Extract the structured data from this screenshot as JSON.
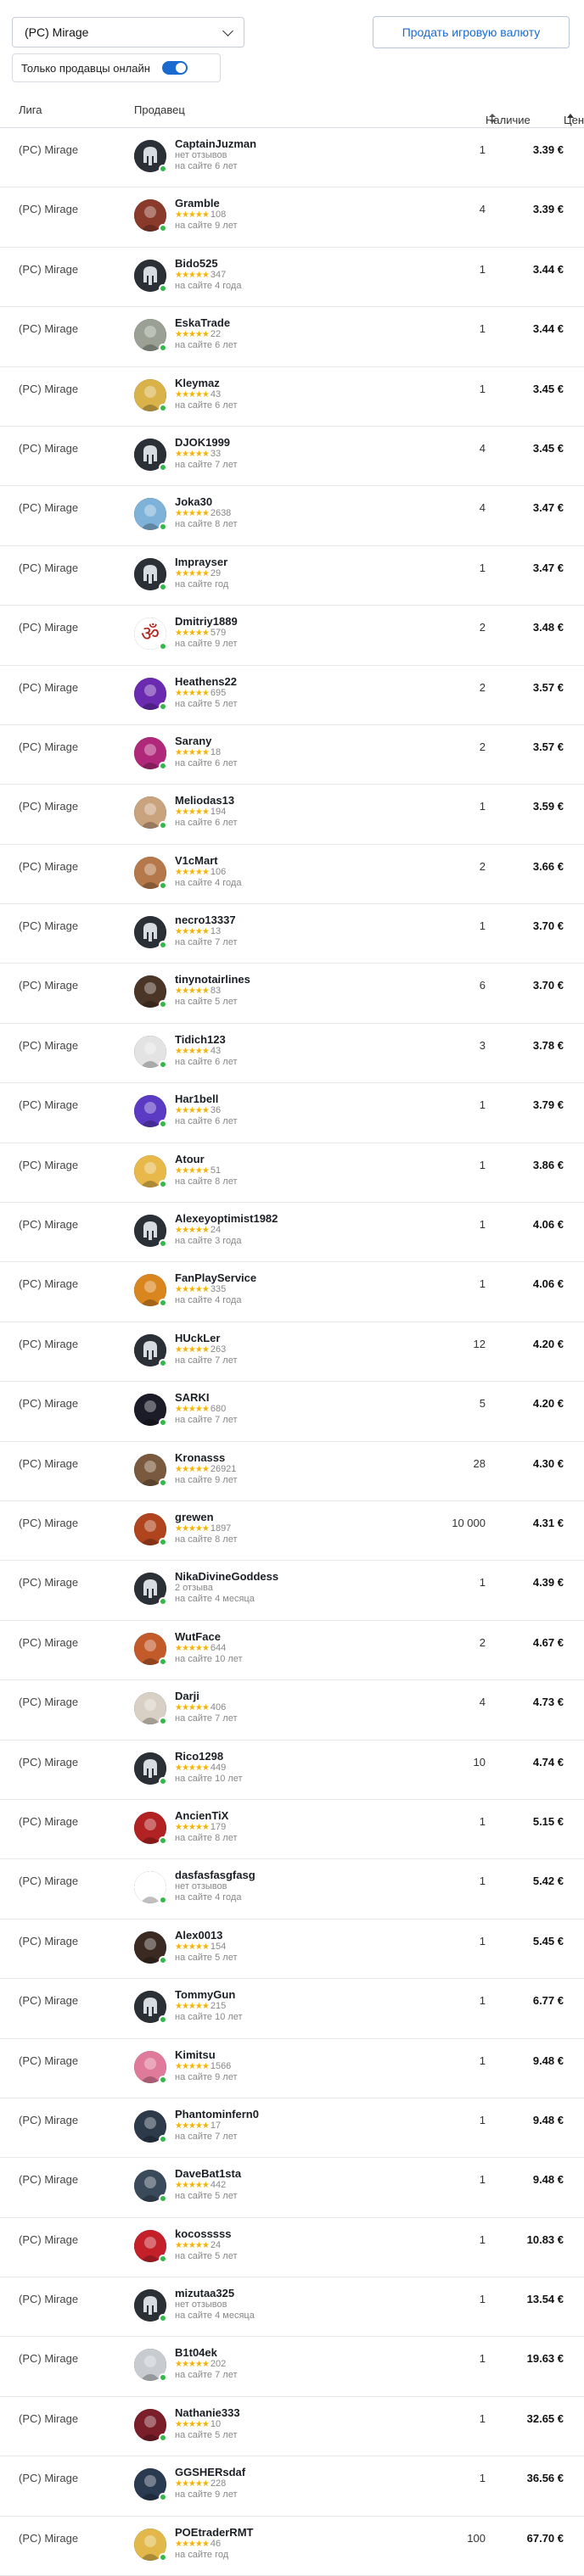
{
  "league_select": {
    "value": "(PC) Mirage"
  },
  "sell_button": "Продать игровую валюту",
  "online_filter": {
    "label": "Только продавцы онлайн",
    "enabled": true
  },
  "columns": {
    "league": "Лига",
    "seller": "Продавец",
    "stock": "Наличие",
    "price": "Цена"
  },
  "rows": [
    {
      "league": "(PC) Mirage",
      "name": "CaptainJuzman",
      "rating": "нет отзывов",
      "age": "на сайте 6 лет",
      "stock": "1",
      "price": "3.39 €",
      "avatar_color": "#2b2f36",
      "avatar_icon": "helmet-icon"
    },
    {
      "league": "(PC) Mirage",
      "name": "Gramble",
      "rating": "108",
      "age": "на сайте 9 лет",
      "stock": "4",
      "price": "3.39 €",
      "avatar_color": "#8a3a2a",
      "avatar_icon": "character-icon"
    },
    {
      "league": "(PC) Mirage",
      "name": "Bido525",
      "rating": "347",
      "age": "на сайте 4 года",
      "stock": "1",
      "price": "3.44 €",
      "avatar_color": "#2b2f36",
      "avatar_icon": "helmet-icon"
    },
    {
      "league": "(PC) Mirage",
      "name": "EskaTrade",
      "rating": "22",
      "age": "на сайте 6 лет",
      "stock": "1",
      "price": "3.44 €",
      "avatar_color": "#9aa093",
      "avatar_icon": "character-icon"
    },
    {
      "league": "(PC) Mirage",
      "name": "Kleymaz",
      "rating": "43",
      "age": "на сайте 6 лет",
      "stock": "1",
      "price": "3.45 €",
      "avatar_color": "#d9b24a",
      "avatar_icon": "character-icon"
    },
    {
      "league": "(PC) Mirage",
      "name": "DJOK1999",
      "rating": "33",
      "age": "на сайте 7 лет",
      "stock": "4",
      "price": "3.45 €",
      "avatar_color": "#2b2f36",
      "avatar_icon": "helmet-icon"
    },
    {
      "league": "(PC) Mirage",
      "name": "Joka30",
      "rating": "2638",
      "age": "на сайте 8 лет",
      "stock": "4",
      "price": "3.47 €",
      "avatar_color": "#7fb2d8",
      "avatar_icon": "character-icon"
    },
    {
      "league": "(PC) Mirage",
      "name": "Imprayser",
      "rating": "29",
      "age": "на сайте год",
      "stock": "1",
      "price": "3.47 €",
      "avatar_color": "#2b2f36",
      "avatar_icon": "helmet-icon"
    },
    {
      "league": "(PC) Mirage",
      "name": "Dmitriy1889",
      "rating": "579",
      "age": "на сайте 9 лет",
      "stock": "2",
      "price": "3.48 €",
      "avatar_color": "#b3261e",
      "avatar_icon": "om-symbol-icon"
    },
    {
      "league": "(PC) Mirage",
      "name": "Heathens22",
      "rating": "695",
      "age": "на сайте 5 лет",
      "stock": "2",
      "price": "3.57 €",
      "avatar_color": "#6a2bb0",
      "avatar_icon": "character-icon"
    },
    {
      "league": "(PC) Mirage",
      "name": "Sarany",
      "rating": "18",
      "age": "на сайте 6 лет",
      "stock": "2",
      "price": "3.57 €",
      "avatar_color": "#b0287a",
      "avatar_icon": "character-icon"
    },
    {
      "league": "(PC) Mirage",
      "name": "Meliodas13",
      "rating": "194",
      "age": "на сайте 6 лет",
      "stock": "1",
      "price": "3.59 €",
      "avatar_color": "#c9a27e",
      "avatar_icon": "character-icon"
    },
    {
      "league": "(PC) Mirage",
      "name": "V1cMart",
      "rating": "106",
      "age": "на сайте 4 года",
      "stock": "2",
      "price": "3.66 €",
      "avatar_color": "#b5784a",
      "avatar_icon": "character-icon"
    },
    {
      "league": "(PC) Mirage",
      "name": "necro13337",
      "rating": "13",
      "age": "на сайте 7 лет",
      "stock": "1",
      "price": "3.70 €",
      "avatar_color": "#2b2f36",
      "avatar_icon": "helmet-icon"
    },
    {
      "league": "(PC) Mirage",
      "name": "tinynotairlines",
      "rating": "83",
      "age": "на сайте 5 лет",
      "stock": "6",
      "price": "3.70 €",
      "avatar_color": "#4a3526",
      "avatar_icon": "character-icon"
    },
    {
      "league": "(PC) Mirage",
      "name": "Tidich123",
      "rating": "43",
      "age": "на сайте 6 лет",
      "stock": "3",
      "price": "3.78 €",
      "avatar_color": "#e3e3e3",
      "avatar_icon": "character-icon"
    },
    {
      "league": "(PC) Mirage",
      "name": "Har1bell",
      "rating": "36",
      "age": "на сайте 6 лет",
      "stock": "1",
      "price": "3.79 €",
      "avatar_color": "#5b3bc4",
      "avatar_icon": "character-icon"
    },
    {
      "league": "(PC) Mirage",
      "name": "Atour",
      "rating": "51",
      "age": "на сайте 8 лет",
      "stock": "1",
      "price": "3.86 €",
      "avatar_color": "#e8b84a",
      "avatar_icon": "character-icon"
    },
    {
      "league": "(PC) Mirage",
      "name": "Alexeyoptimist1982",
      "rating": "24",
      "age": "на сайте 3 года",
      "stock": "1",
      "price": "4.06 €",
      "avatar_color": "#2b2f36",
      "avatar_icon": "helmet-icon"
    },
    {
      "league": "(PC) Mirage",
      "name": "FanPlayService",
      "rating": "335",
      "age": "на сайте 4 года",
      "stock": "1",
      "price": "4.06 €",
      "avatar_color": "#d9861e",
      "avatar_icon": "character-icon"
    },
    {
      "league": "(PC) Mirage",
      "name": "HUckLer",
      "rating": "263",
      "age": "на сайте 7 лет",
      "stock": "12",
      "price": "4.20 €",
      "avatar_color": "#2b2f36",
      "avatar_icon": "helmet-icon"
    },
    {
      "league": "(PC) Mirage",
      "name": "SARKI",
      "rating": "680",
      "age": "на сайте 7 лет",
      "stock": "5",
      "price": "4.20 €",
      "avatar_color": "#1c1c28",
      "avatar_icon": "character-icon"
    },
    {
      "league": "(PC) Mirage",
      "name": "Kronasss",
      "rating": "26921",
      "age": "на сайте 9 лет",
      "stock": "28",
      "price": "4.30 €",
      "avatar_color": "#7a5a3e",
      "avatar_icon": "character-icon"
    },
    {
      "league": "(PC) Mirage",
      "name": "grewen",
      "rating": "1897",
      "age": "на сайте 8 лет",
      "stock": "10 000",
      "price": "4.31 €",
      "avatar_color": "#b0441e",
      "avatar_icon": "character-icon"
    },
    {
      "league": "(PC) Mirage",
      "name": "NikaDivineGoddess",
      "rating": "2 отзыва",
      "age": "на сайте 4 месяца",
      "stock": "1",
      "price": "4.39 €",
      "avatar_color": "#2b2f36",
      "avatar_icon": "helmet-icon"
    },
    {
      "league": "(PC) Mirage",
      "name": "WutFace",
      "rating": "644",
      "age": "на сайте 10 лет",
      "stock": "2",
      "price": "4.67 €",
      "avatar_color": "#c25a2a",
      "avatar_icon": "character-icon"
    },
    {
      "league": "(PC) Mirage",
      "name": "Darji",
      "rating": "406",
      "age": "на сайте 7 лет",
      "stock": "4",
      "price": "4.73 €",
      "avatar_color": "#d8d0c4",
      "avatar_icon": "character-icon"
    },
    {
      "league": "(PC) Mirage",
      "name": "Rico1298",
      "rating": "449",
      "age": "на сайте 10 лет",
      "stock": "10",
      "price": "4.74 €",
      "avatar_color": "#2b2f36",
      "avatar_icon": "helmet-icon"
    },
    {
      "league": "(PC) Mirage",
      "name": "AncienTiX",
      "rating": "179",
      "age": "на сайте 8 лет",
      "stock": "1",
      "price": "5.15 €",
      "avatar_color": "#b32222",
      "avatar_icon": "character-icon"
    },
    {
      "league": "(PC) Mirage",
      "name": "dasfasfasgfasg",
      "rating": "нет отзывов",
      "age": "на сайте 4 года",
      "stock": "1",
      "price": "5.42 €",
      "avatar_color": "#ffffff",
      "avatar_icon": "character-icon"
    },
    {
      "league": "(PC) Mirage",
      "name": "Alex0013",
      "rating": "154",
      "age": "на сайте 5 лет",
      "stock": "1",
      "price": "5.45 €",
      "avatar_color": "#3a2a22",
      "avatar_icon": "character-icon"
    },
    {
      "league": "(PC) Mirage",
      "name": "TommyGun",
      "rating": "215",
      "age": "на сайте 10 лет",
      "stock": "1",
      "price": "6.77 €",
      "avatar_color": "#2b2f36",
      "avatar_icon": "helmet-icon"
    },
    {
      "league": "(PC) Mirage",
      "name": "Kimitsu",
      "rating": "1566",
      "age": "на сайте 9 лет",
      "stock": "1",
      "price": "9.48 €",
      "avatar_color": "#e07a9a",
      "avatar_icon": "character-icon"
    },
    {
      "league": "(PC) Mirage",
      "name": "Phantominfern0",
      "rating": "17",
      "age": "на сайте 7 лет",
      "stock": "1",
      "price": "9.48 €",
      "avatar_color": "#2c3a4a",
      "avatar_icon": "character-icon"
    },
    {
      "league": "(PC) Mirage",
      "name": "DaveBat1sta",
      "rating": "442",
      "age": "на сайте 5 лет",
      "stock": "1",
      "price": "9.48 €",
      "avatar_color": "#3a4a5a",
      "avatar_icon": "character-icon"
    },
    {
      "league": "(PC) Mirage",
      "name": "kocosssss",
      "rating": "24",
      "age": "на сайте 5 лет",
      "stock": "1",
      "price": "10.83 €",
      "avatar_color": "#c4202a",
      "avatar_icon": "character-icon"
    },
    {
      "league": "(PC) Mirage",
      "name": "mizutaa325",
      "rating": "нет отзывов",
      "age": "на сайте 4 месяца",
      "stock": "1",
      "price": "13.54 €",
      "avatar_color": "#2b2f36",
      "avatar_icon": "helmet-icon"
    },
    {
      "league": "(PC) Mirage",
      "name": "B1t04ek",
      "rating": "202",
      "age": "на сайте 7 лет",
      "stock": "1",
      "price": "19.63 €",
      "avatar_color": "#c8ccd0",
      "avatar_icon": "character-icon"
    },
    {
      "league": "(PC) Mirage",
      "name": "Nathanie333",
      "rating": "10",
      "age": "на сайте 5 лет",
      "stock": "1",
      "price": "32.65 €",
      "avatar_color": "#7a1e2a",
      "avatar_icon": "character-icon"
    },
    {
      "league": "(PC) Mirage",
      "name": "GGSHERsdaf",
      "rating": "228",
      "age": "на сайте 9 лет",
      "stock": "1",
      "price": "36.56 €",
      "avatar_color": "#2a3a50",
      "avatar_icon": "character-icon"
    },
    {
      "league": "(PC) Mirage",
      "name": "POEtraderRMT",
      "rating": "46",
      "age": "на сайте год",
      "stock": "100",
      "price": "67.70 €",
      "avatar_color": "#e2b84a",
      "avatar_icon": "character-icon"
    }
  ]
}
